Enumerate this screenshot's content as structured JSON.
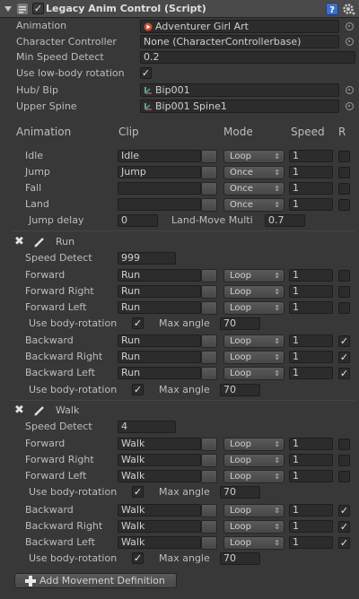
{
  "header": {
    "title": "Legacy Anim Control (Script)",
    "enabled": true
  },
  "props": {
    "animation_label": "Animation",
    "animation_value": "Adventurer Girl Art",
    "cc_label": "Character Controller",
    "cc_value": "None (CharacterControllerbase)",
    "minspeed_label": "Min Speed Detect",
    "minspeed_value": "0.2",
    "lowbody_label": "Use low-body rotation",
    "lowbody_checked": true,
    "hub_label": "Hub/ Bip",
    "hub_value": "Bip001",
    "spine_label": "Upper Spine",
    "spine_value": "Bip001 Spine1"
  },
  "anim_table": {
    "headers": {
      "animation": "Animation",
      "clip": "Clip",
      "mode": "Mode",
      "speed": "Speed",
      "r": "R"
    },
    "rows": [
      {
        "name": "Idle",
        "clip": "Idle",
        "mode": "Loop",
        "speed": "1",
        "r": false
      },
      {
        "name": "Jump",
        "clip": "Jump",
        "mode": "Once",
        "speed": "1",
        "r": false
      },
      {
        "name": "Fall",
        "clip": "",
        "mode": "Once",
        "speed": "1",
        "r": false
      },
      {
        "name": "Land",
        "clip": "",
        "mode": "Once",
        "speed": "1",
        "r": false
      }
    ],
    "jump_delay_label": "Jump delay",
    "jump_delay_value": "0",
    "land_move_label": "Land-Move Multi",
    "land_move_value": "0.7"
  },
  "movements": [
    {
      "name": "Run",
      "speed_detect_label": "Speed Detect",
      "speed_detect": "999",
      "rows": [
        {
          "name": "Forward",
          "clip": "Run",
          "mode": "Loop",
          "speed": "1",
          "r": false
        },
        {
          "name": "Forward Right",
          "clip": "Run",
          "mode": "Loop",
          "speed": "1",
          "r": false
        },
        {
          "name": "Forward Left",
          "clip": "Run",
          "mode": "Loop",
          "speed": "1",
          "r": false
        },
        {
          "name": "Backward",
          "clip": "Run",
          "mode": "Loop",
          "speed": "1",
          "r": true
        },
        {
          "name": "Backward Right",
          "clip": "Run",
          "mode": "Loop",
          "speed": "1",
          "r": true
        },
        {
          "name": "Backward Left",
          "clip": "Run",
          "mode": "Loop",
          "speed": "1",
          "r": true
        }
      ],
      "body_rot_label": "Use body-rotation",
      "body_rot_1": true,
      "body_rot_2": true,
      "max_angle_label": "Max angle",
      "max_angle_1": "70",
      "max_angle_2": "70"
    },
    {
      "name": "Walk",
      "speed_detect_label": "Speed Detect",
      "speed_detect": "4",
      "rows": [
        {
          "name": "Forward",
          "clip": "Walk",
          "mode": "Loop",
          "speed": "1",
          "r": false
        },
        {
          "name": "Forward Right",
          "clip": "Walk",
          "mode": "Loop",
          "speed": "1",
          "r": false
        },
        {
          "name": "Forward Left",
          "clip": "Walk",
          "mode": "Loop",
          "speed": "1",
          "r": false
        },
        {
          "name": "Backward",
          "clip": "Walk",
          "mode": "Loop",
          "speed": "1",
          "r": true
        },
        {
          "name": "Backward Right",
          "clip": "Walk",
          "mode": "Loop",
          "speed": "1",
          "r": true
        },
        {
          "name": "Backward Left",
          "clip": "Walk",
          "mode": "Loop",
          "speed": "1",
          "r": true
        }
      ],
      "body_rot_label": "Use body-rotation",
      "body_rot_1": true,
      "body_rot_2": true,
      "max_angle_label": "Max angle",
      "max_angle_1": "70",
      "max_angle_2": "70"
    }
  ],
  "add_button_label": "Add Movement Definition",
  "colors": {
    "bg": "#383838",
    "header": "#4a4a4a",
    "field": "#2c2c2c",
    "text": "#bdbdbd"
  }
}
